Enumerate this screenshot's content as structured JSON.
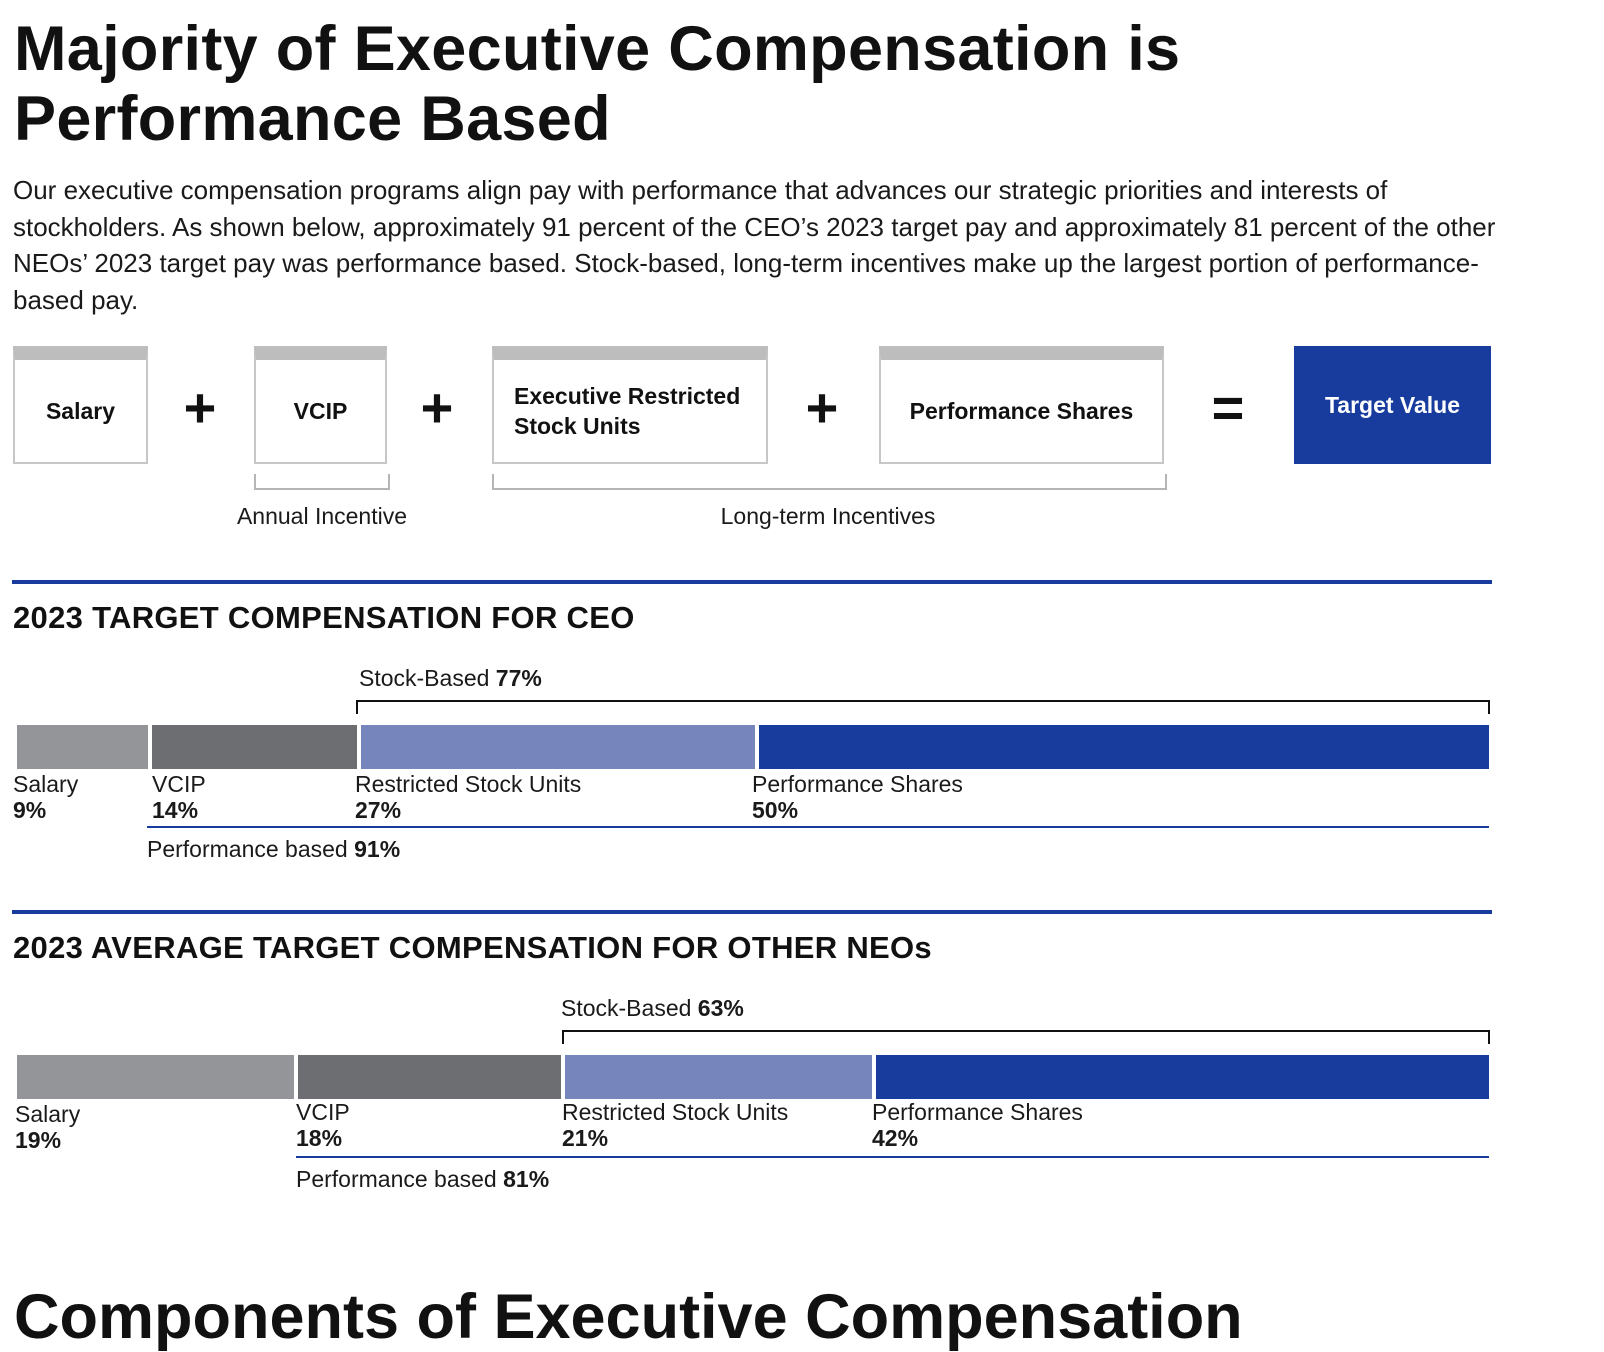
{
  "title": "Majority of Executive Compensation is Performance Based",
  "intro": "Our executive compensation programs align pay with performance that advances our strategic priorities and interests of stockholders. As shown below, approximately 91 percent of the CEO’s 2023 target pay and approximately 81 percent of the other NEOs’ 2023 target pay was performance based. Stock-based, long-term incentives make up the largest portion of performance-based pay.",
  "formula": {
    "items": [
      "Salary",
      "VCIP",
      "Executive Restricted Stock Units",
      "Performance Shares"
    ],
    "plus": "+",
    "equals": "=",
    "result": "Target Value",
    "annual_label": "Annual Incentive",
    "longterm_label": "Long-term Incentives"
  },
  "colors": {
    "salary": "#939598",
    "vcip": "#6d6e71",
    "rsu": "#7686bc",
    "performance_shares": "#183c9e",
    "rule": "#183c9e"
  },
  "chart_data": [
    {
      "type": "bar",
      "orientation": "horizontal-stacked",
      "title": "2023 TARGET COMPENSATION FOR CEO",
      "categories": [
        "Salary",
        "VCIP",
        "Restricted Stock Units",
        "Performance Shares"
      ],
      "values": [
        9,
        14,
        27,
        50
      ],
      "value_labels": [
        "9%",
        "14%",
        "27%",
        "50%"
      ],
      "stock_based": {
        "label": "Stock-Based",
        "value": "77%"
      },
      "performance_based": {
        "label": "Performance based",
        "value": "91%"
      }
    },
    {
      "type": "bar",
      "orientation": "horizontal-stacked",
      "title": "2023 AVERAGE TARGET COMPENSATION FOR OTHER NEOs",
      "categories": [
        "Salary",
        "VCIP",
        "Restricted Stock Units",
        "Performance Shares"
      ],
      "values": [
        19,
        18,
        21,
        42
      ],
      "value_labels": [
        "19%",
        "18%",
        "21%",
        "42%"
      ],
      "stock_based": {
        "label": "Stock-Based",
        "value": "63%"
      },
      "performance_based": {
        "label": "Performance based",
        "value": "81%"
      }
    }
  ],
  "next_heading": "Components of Executive Compensation"
}
